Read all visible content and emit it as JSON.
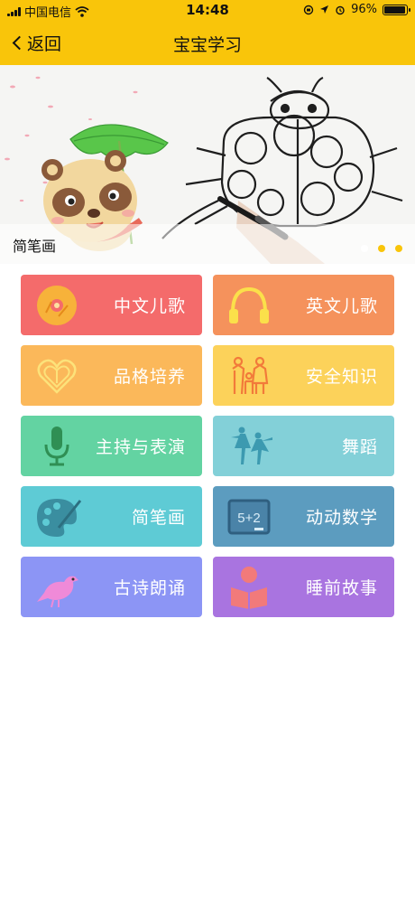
{
  "status_bar": {
    "carrier": "中国电信",
    "time": "14:48",
    "battery": "96%",
    "battery_level": 0.96
  },
  "nav": {
    "back_label": "返回",
    "title": "宝宝学习"
  },
  "banner": {
    "caption": "简笔画",
    "page_count": 3,
    "active_index": 0,
    "colors": {
      "active_dot": "#ffffff",
      "inactive_dot": "#f9c50a"
    }
  },
  "tiles": [
    {
      "label": "中文儿歌",
      "color": "#f46b6b",
      "icon": "cd-disc-icon"
    },
    {
      "label": "英文儿歌",
      "color": "#f5925c",
      "icon": "headphones-icon"
    },
    {
      "label": "品格培养",
      "color": "#fbb85a",
      "icon": "heart-icon"
    },
    {
      "label": "安全知识",
      "color": "#fcd25a",
      "icon": "family-icon"
    },
    {
      "label": "主持与表演",
      "color": "#63d3a2",
      "icon": "microphone-icon"
    },
    {
      "label": "舞蹈",
      "color": "#83d0d8",
      "icon": "dancers-icon"
    },
    {
      "label": "简笔画",
      "color": "#5ecbd5",
      "icon": "palette-icon"
    },
    {
      "label": "动动数学",
      "color": "#5c9cbf",
      "icon": "math-board-icon"
    },
    {
      "label": "古诗朗诵",
      "color": "#8c95f5",
      "icon": "bird-icon"
    },
    {
      "label": "睡前故事",
      "color": "#a974e0",
      "icon": "reading-child-icon"
    }
  ],
  "icon_board_text": "5+2",
  "colors": {
    "header": "#f9c50a",
    "background": "#ffffff"
  }
}
